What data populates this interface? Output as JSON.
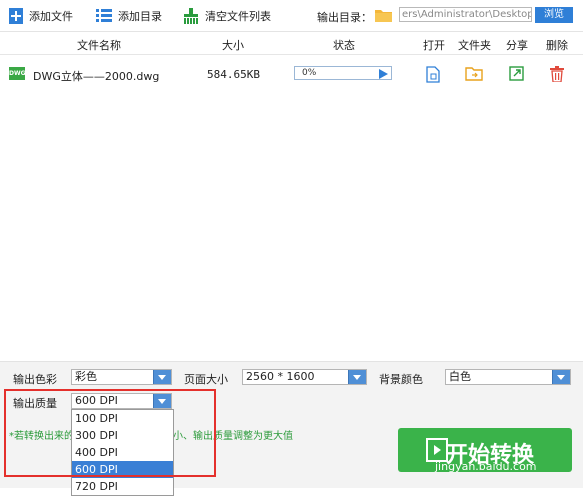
{
  "toolbar": {
    "add_file": "添加文件",
    "add_dir": "添加目录",
    "clear_list": "清空文件列表",
    "output_dir_label": "输出目录：",
    "output_dir_value": "ers\\Administrator\\Desktop",
    "browse": "浏览"
  },
  "table": {
    "headers": {
      "name": "文件名称",
      "size": "大小",
      "status": "状态",
      "open": "打开",
      "folder": "文件夹",
      "share": "分享",
      "delete": "删除"
    },
    "rows": [
      {
        "icon_text": "DWG",
        "name": "DWG立体——2000.dwg",
        "size": "584.65KB",
        "progress_text": "0%",
        "progress": 0
      }
    ]
  },
  "options": {
    "color_label": "输出色彩",
    "color_value": "彩色",
    "page_size_label": "页面大小",
    "page_size_value": "2560 * 1600",
    "bg_color_label": "背景颜色",
    "bg_color_value": "白色",
    "quality_label": "输出质量",
    "quality_value": "600 DPI",
    "quality_options": [
      "100 DPI",
      "300 DPI",
      "400 DPI",
      "600 DPI",
      "720 DPI"
    ],
    "quality_selected": "600 DPI"
  },
  "hint": {
    "part1": "*若转换出来的",
    "part2": "小、输出质量调整为更大值"
  },
  "start_button": "开始转换",
  "watermark": "jingyan.baidu.com",
  "colors": {
    "accent": "#2f7fd7",
    "green": "#3ab34a",
    "highlight_box": "#e4302c",
    "hint_green": "#2c9b3b"
  }
}
